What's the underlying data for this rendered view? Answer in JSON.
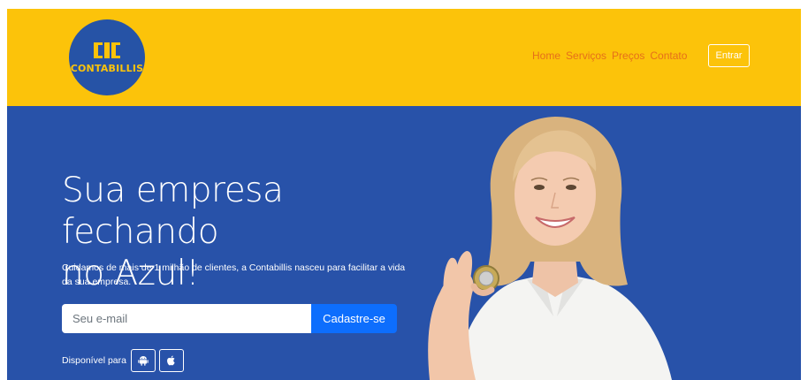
{
  "header": {
    "logo_text": "CONTABILLIS",
    "nav": [
      "Home",
      "Serviços",
      "Preços",
      "Contato"
    ],
    "login_label": "Entrar"
  },
  "hero": {
    "headline_line1": "Sua empresa fechando",
    "headline_line2": "no Azul!",
    "subtitle": "Cuidamos de mais de 1 milhão de clientes, a Contabillis nasceu para facilitar a vida da sua empresa.",
    "email_placeholder": "Seu e-mail",
    "signup_label": "Cadastre-se",
    "available_label": "Disponível para"
  },
  "icons": {
    "android": "android-icon",
    "apple": "apple-icon"
  },
  "colors": {
    "header_bg": "#fcc30a",
    "hero_bg": "#2852a9",
    "logo_bg": "#2653a6",
    "nav_text": "#e66f1a",
    "signup_button": "#0d6efd"
  }
}
